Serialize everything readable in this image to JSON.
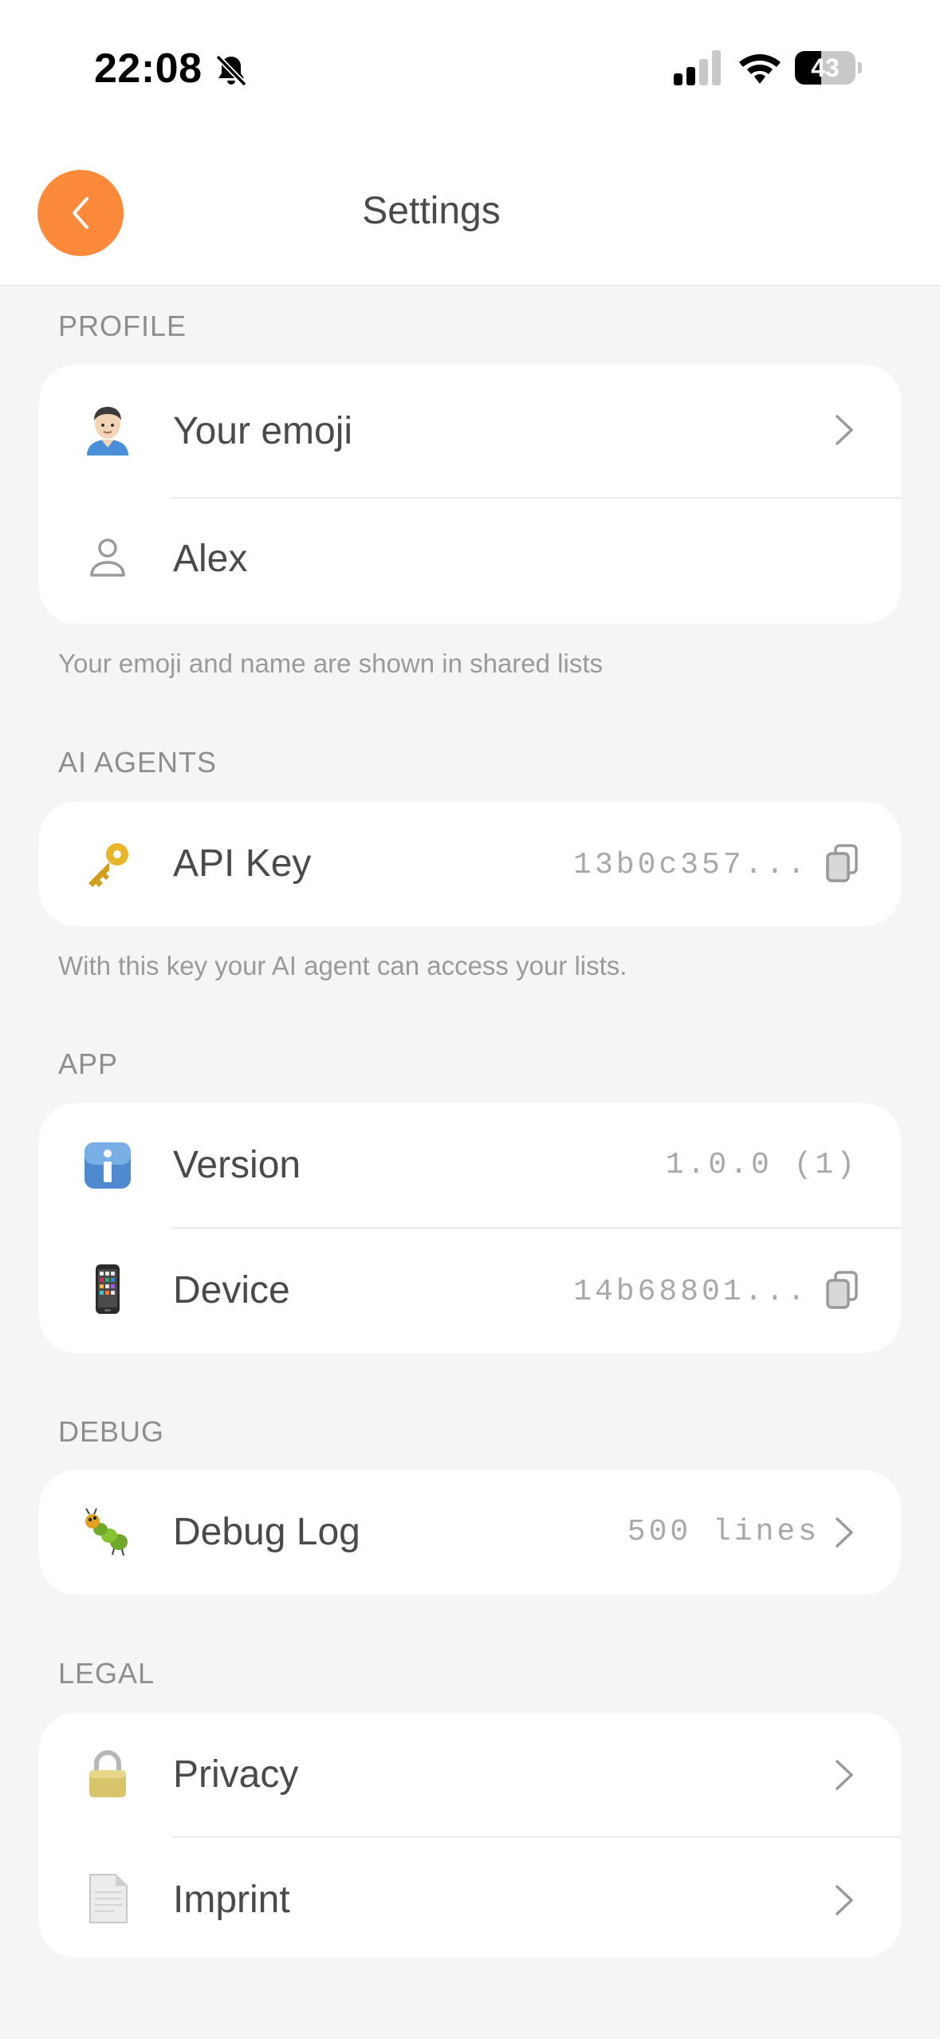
{
  "status_bar": {
    "time": "22:08",
    "battery": "43",
    "battery_level": 0.43,
    "icons": [
      "bell-slash-icon",
      "cellular-signal-icon",
      "wifi-icon",
      "battery-icon"
    ]
  },
  "nav": {
    "title": "Settings",
    "back_icon": "chevron-left-icon"
  },
  "colors": {
    "accent": "#fd8a3b",
    "background": "#f5f5f5",
    "card": "#ffffff",
    "text": "#4a4a4a",
    "secondary_text": "#8e8e8e"
  },
  "sections": {
    "profile": {
      "header": "PROFILE",
      "footer": "Your emoji and name are shown in shared lists",
      "rows": [
        {
          "label": "Your emoji",
          "icon": "man-emoji-icon",
          "accessory": "chevron-right-icon"
        },
        {
          "label": "Alex",
          "icon": "person-outline-icon"
        }
      ]
    },
    "ai_agents": {
      "header": "AI AGENTS",
      "footer": "With this key your AI agent can access your lists.",
      "rows": [
        {
          "label": "API Key",
          "value": "13b0c357...",
          "icon": "key-emoji-icon",
          "accessory": "copy-icon"
        }
      ]
    },
    "app": {
      "header": "APP",
      "rows": [
        {
          "label": "Version",
          "value": "1.0.0 (1)",
          "icon": "info-emoji-icon"
        },
        {
          "label": "Device",
          "value": "14b68801...",
          "icon": "mobile-phone-emoji-icon",
          "accessory": "copy-icon"
        }
      ]
    },
    "debug": {
      "header": "DEBUG",
      "rows": [
        {
          "label": "Debug Log",
          "value": "500 lines",
          "icon": "bug-emoji-icon",
          "accessory": "chevron-right-icon"
        }
      ]
    },
    "legal": {
      "header": "LEGAL",
      "rows": [
        {
          "label": "Privacy",
          "icon": "lock-emoji-icon",
          "accessory": "chevron-right-icon"
        },
        {
          "label": "Imprint",
          "icon": "page-emoji-icon",
          "accessory": "chevron-right-icon"
        }
      ]
    }
  }
}
